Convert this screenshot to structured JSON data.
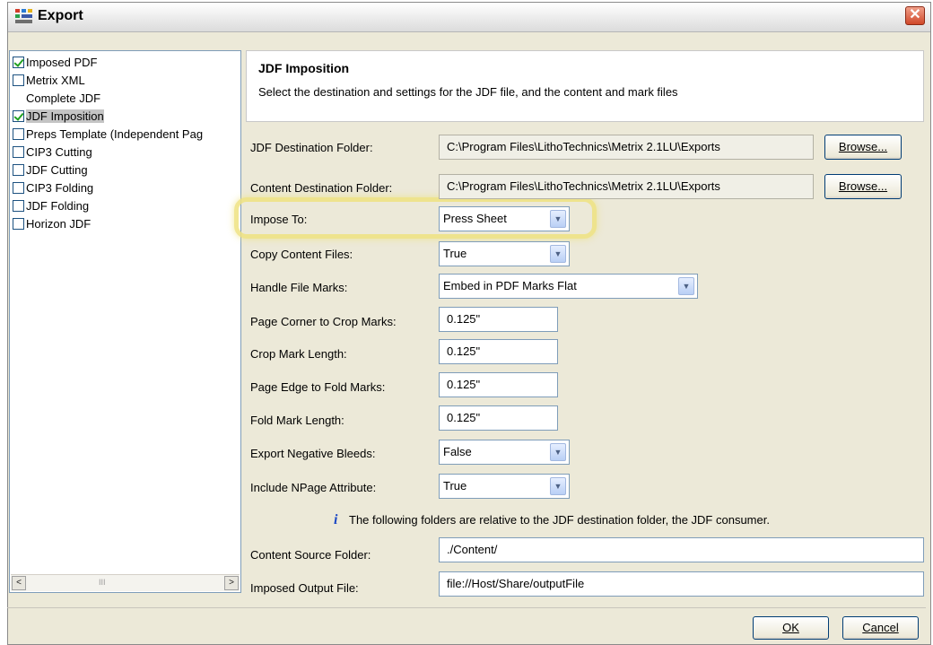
{
  "window": {
    "title": "Export",
    "close_glyph": "✕"
  },
  "export_list": {
    "items": [
      {
        "label": "Imposed PDF",
        "checked": true,
        "has_checkbox": true
      },
      {
        "label": "Metrix XML",
        "checked": false,
        "has_checkbox": true
      },
      {
        "label": "Complete JDF",
        "checked": false,
        "has_checkbox": false
      },
      {
        "label": "JDF Imposition",
        "checked": true,
        "has_checkbox": true,
        "selected": true
      },
      {
        "label": "Preps Template (Independent Pag",
        "checked": false,
        "has_checkbox": true
      },
      {
        "label": "CIP3 Cutting",
        "checked": false,
        "has_checkbox": true
      },
      {
        "label": "JDF Cutting",
        "checked": false,
        "has_checkbox": true
      },
      {
        "label": "CIP3 Folding",
        "checked": false,
        "has_checkbox": true
      },
      {
        "label": "JDF Folding",
        "checked": false,
        "has_checkbox": true
      },
      {
        "label": "Horizon JDF",
        "checked": false,
        "has_checkbox": true
      }
    ],
    "scroll_left": "<",
    "scroll_right": ">",
    "scroll_grip": "III"
  },
  "header": {
    "title": "JDF Imposition",
    "description": "Select the destination and settings for the JDF file, and the content and mark files"
  },
  "form": {
    "jdf_dest": {
      "label": "JDF Destination Folder:",
      "value": "C:\\Program Files\\LithoTechnics\\Metrix 2.1LU\\Exports",
      "button": "Browse..."
    },
    "content_dest": {
      "label": "Content Destination Folder:",
      "value": "C:\\Program Files\\LithoTechnics\\Metrix 2.1LU\\Exports",
      "button": "Browse..."
    },
    "impose_to": {
      "label": "Impose To:",
      "value": "Press Sheet"
    },
    "copy_content": {
      "label": "Copy Content Files:",
      "value": "True"
    },
    "file_marks": {
      "label": "Handle File Marks:",
      "value": "Embed in PDF Marks Flat"
    },
    "corner_crop": {
      "label": "Page Corner to Crop Marks:",
      "value": "0.125\""
    },
    "crop_length": {
      "label": "Crop Mark Length:",
      "value": "0.125\""
    },
    "edge_fold": {
      "label": "Page Edge to Fold Marks:",
      "value": "0.125\""
    },
    "fold_length": {
      "label": "Fold Mark Length:",
      "value": "0.125\""
    },
    "neg_bleeds": {
      "label": "Export Negative Bleeds:",
      "value": "False"
    },
    "npage": {
      "label": "Include NPage Attribute:",
      "value": "True"
    },
    "info": {
      "icon": "i",
      "text": "The following folders are relative to the JDF destination folder, the JDF consumer."
    },
    "content_source": {
      "label": "Content Source Folder:",
      "value": "./Content/"
    },
    "output_file": {
      "label": "Imposed Output File:",
      "value": "file://Host/Share/outputFile"
    }
  },
  "footer": {
    "ok": "OK",
    "cancel": "Cancel"
  },
  "colors": {
    "highlight": "#eee280",
    "window_bg": "#ece9d8",
    "field_border": "#7f9db9"
  }
}
